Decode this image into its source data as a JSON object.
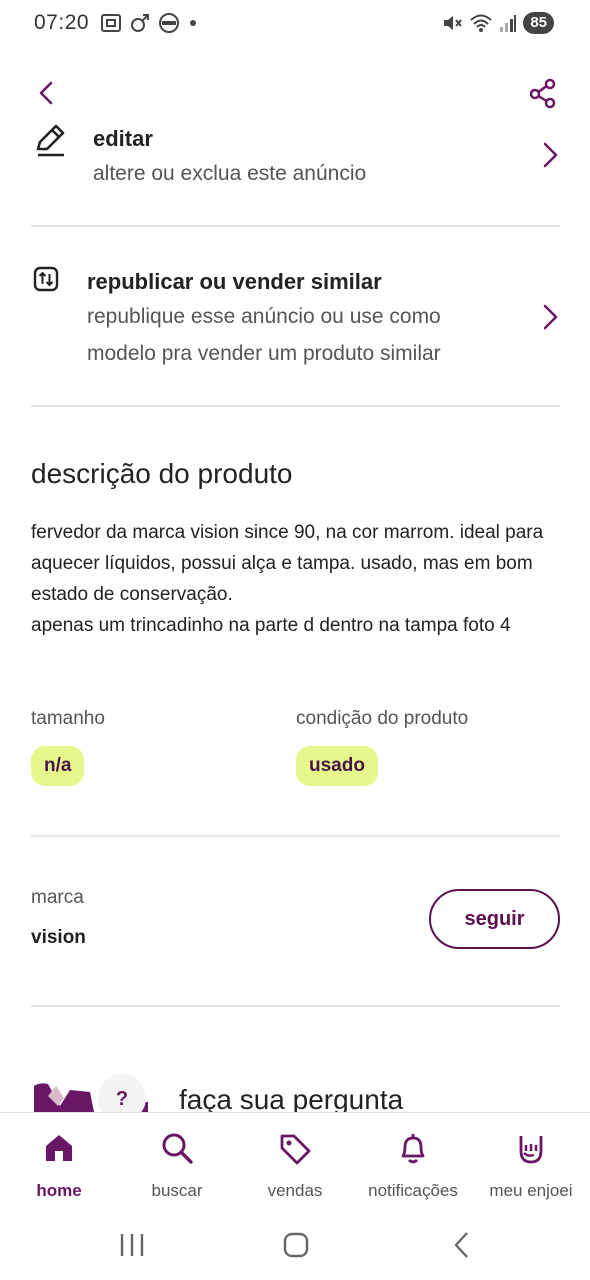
{
  "status_bar": {
    "time": "07:20",
    "battery": "85",
    "icons": [
      "screenshot-icon",
      "gender-icon",
      "app-icon",
      "dot-icon",
      "mute-icon",
      "wifi-icon",
      "signal-icon"
    ]
  },
  "nav": {
    "back_icon": "chevron-left-icon",
    "share_icon": "share-icon"
  },
  "actions": [
    {
      "icon": "pencil-icon",
      "title": "editar",
      "subtitle": "altere ou exclua este anúncio"
    },
    {
      "icon": "republish-icon",
      "title": "republicar ou vender similar",
      "subtitle_line1": "republique esse anúncio ou use como",
      "subtitle_line2": "modelo pra vender um produto similar"
    }
  ],
  "description": {
    "title": "descrição do produto",
    "text": "fervedor da marca vision since 90, na cor marrom. ideal para aquecer líquidos, possui alça e tampa. usado, mas em bom estado de conservação.\napenas um trincadinho na parte d dentro na tampa foto 4"
  },
  "attributes": {
    "size_label": "tamanho",
    "size_value": "n/a",
    "condition_label": "condição do produto",
    "condition_value": "usado"
  },
  "brand": {
    "label": "marca",
    "value": "vision",
    "follow_label": "seguir"
  },
  "ask": {
    "title": "faça sua pergunta",
    "badge": "?"
  },
  "bottom_nav": [
    {
      "label": "home",
      "icon": "home-icon",
      "active": true
    },
    {
      "label": "buscar",
      "icon": "search-icon",
      "active": false
    },
    {
      "label": "vendas",
      "icon": "tag-icon",
      "active": false
    },
    {
      "label": "notificações",
      "icon": "bell-icon",
      "active": false
    },
    {
      "label": "meu enjoei",
      "icon": "rock-hand-icon",
      "active": false
    }
  ],
  "colors": {
    "brand_purple": "#6a1667",
    "chip_green": "#e5f88c",
    "chip_text": "#4a1448"
  }
}
